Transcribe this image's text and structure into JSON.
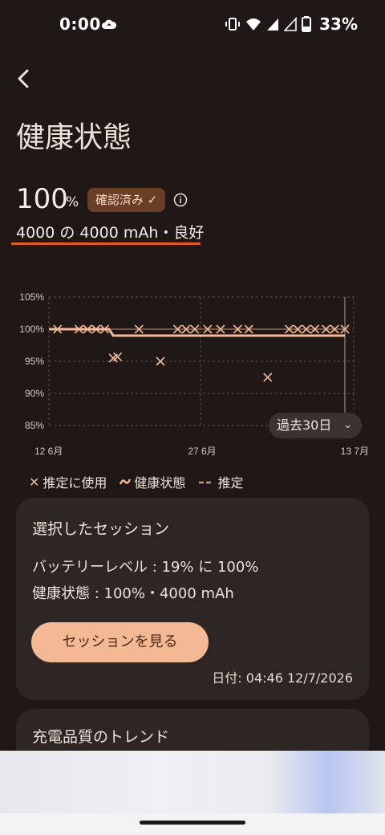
{
  "status_bar": {
    "time": "0:00",
    "battery": "33%"
  },
  "header": {
    "title": "健康状態"
  },
  "summary": {
    "percent": "100",
    "percent_unit": "%",
    "badge": "確認済み ✓",
    "capacity": "4000 の 4000 mAh・良好"
  },
  "chart_data": {
    "type": "scatter",
    "y_ticks": [
      "105%",
      "100%",
      "95%",
      "90%",
      "85%"
    ],
    "x_ticks": [
      "12 6月",
      "27 6月",
      "13 7月"
    ],
    "ylim": [
      85,
      105
    ],
    "xlim": [
      0,
      31
    ],
    "grid": true,
    "legend_position": "bottom",
    "series": [
      {
        "name": "推定に使用",
        "type": "scatter",
        "x": [
          1,
          3.5,
          4.5,
          5.5,
          6.5,
          7.5,
          8,
          10.5,
          13,
          15,
          16,
          17,
          18.5,
          20,
          22,
          23.3,
          25.5,
          28,
          29,
          30,
          31,
          32.3,
          33.3,
          34.5
        ],
        "y": [
          100,
          100,
          100,
          100,
          100,
          95.5,
          95.7,
          100,
          95,
          100,
          100,
          100,
          100,
          100,
          100,
          100,
          92.5,
          100,
          100,
          100,
          100,
          100,
          100,
          100
        ]
      },
      {
        "name": "健康状態",
        "type": "line",
        "x": [
          0,
          7,
          7.5,
          34.5
        ],
        "y": [
          100,
          100,
          99,
          99
        ]
      },
      {
        "name": "推定",
        "type": "line",
        "x": [
          0,
          34.5
        ],
        "y": [
          100,
          100
        ]
      }
    ]
  },
  "chart": {
    "range_label": "過去30日"
  },
  "legend": {
    "used": "推定に使用",
    "health": "健康状態",
    "estimate": "推定"
  },
  "session_card": {
    "title": "選択したセッション",
    "battery_level": "バッテリーレベル : 19% に 100%",
    "health": "健康状態 : 100%・4000 mAh",
    "button": "セッションを見る",
    "date": "日付: 04:46  12/7/2026"
  },
  "trend_card": {
    "title": "充電品質のトレンド"
  },
  "colors": {
    "accent": "#f3b894",
    "underline": "#e85a12",
    "badge_bg": "#6b3f26"
  }
}
